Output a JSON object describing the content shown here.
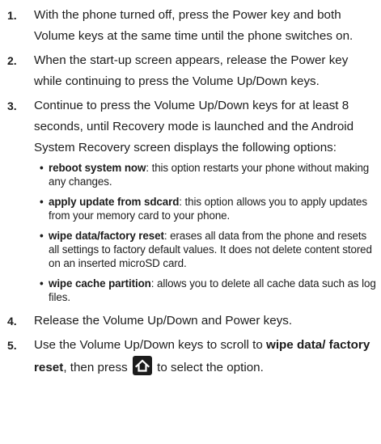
{
  "steps": [
    {
      "number": "1.",
      "text": "With the phone turned off, press the Power key and both Volume keys at the same time until the phone switches on."
    },
    {
      "number": "2.",
      "text": "When the start-up screen appears, release the Power key while continuing to press the Volume Up/Down keys."
    },
    {
      "number": "3.",
      "text": "Continue to press the Volume Up/Down keys for at least 8 seconds, until Recovery mode is launched and the Android System Recovery screen displays the following options:",
      "options": [
        {
          "term": "reboot system now",
          "desc": ": this option restarts your phone without making any changes."
        },
        {
          "term": "apply update from sdcard",
          "desc": ": this option allows you to apply updates from your memory card to your phone."
        },
        {
          "term": "wipe data/factory reset",
          "desc": ": erases all data from the phone and resets all settings to factory default values. It does not delete content stored on an inserted microSD card."
        },
        {
          "term": "wipe cache partition",
          "desc": ": allows you to delete all cache data such as log files."
        }
      ]
    },
    {
      "number": "4.",
      "text": "Release the Volume Up/Down and Power keys."
    },
    {
      "number": "5.",
      "text_before": "Use the Volume Up/Down keys to scroll to ",
      "term": "wipe data/ factory reset",
      "text_middle": ", then press ",
      "icon": "home-key-icon",
      "text_after": " to select the option."
    }
  ],
  "bullet_char": "•",
  "colors": {
    "text": "#1c1c1c",
    "icon_bg": "#1c1c1c",
    "icon_fg": "#ffffff"
  }
}
